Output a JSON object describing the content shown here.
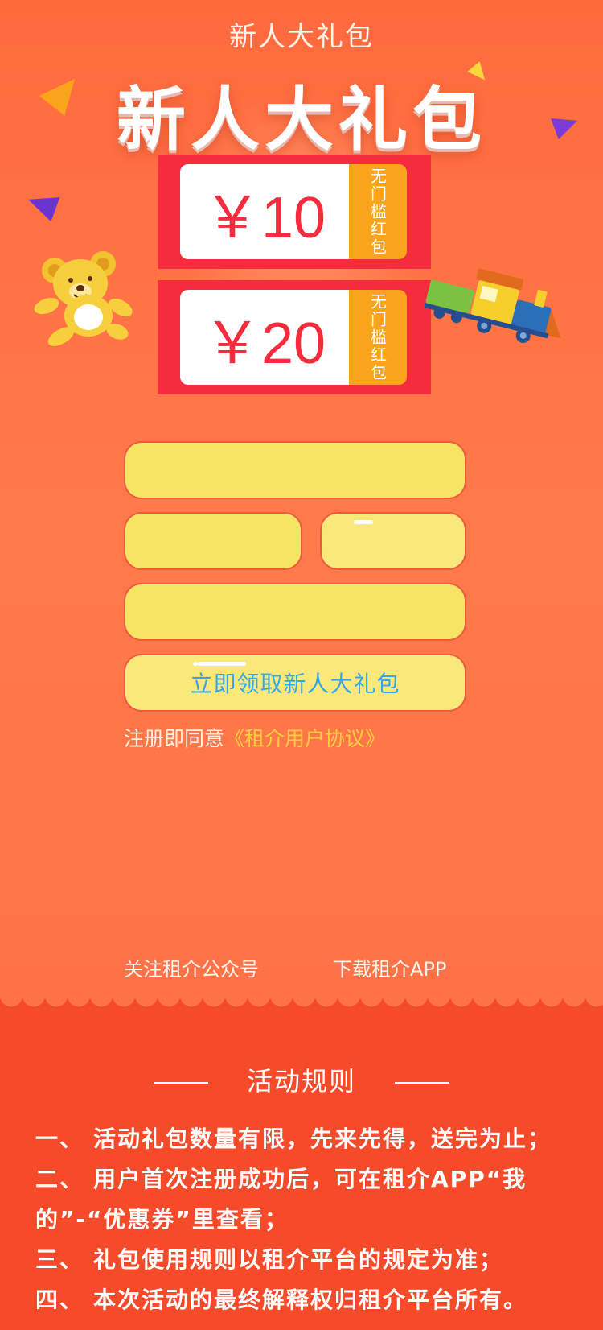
{
  "header": {
    "title": "新人大礼包",
    "hero_title": "新人大礼包"
  },
  "coupons": [
    {
      "amount": "￥10",
      "tag": "无门槛红包"
    },
    {
      "amount": "￥20",
      "tag": "无门槛红包"
    }
  ],
  "form": {
    "phone_value": "",
    "code_value": "",
    "password_value": "",
    "submit_label": "立即领取新人大礼包",
    "agreement_prefix": "注册即同意",
    "agreement_link": "《租介用户协议》"
  },
  "footer_links": {
    "wechat": "关注租介公众号",
    "app": "下载租介APP"
  },
  "rules": {
    "title": "活动规则",
    "items": [
      {
        "num": "一、",
        "text": "活动礼包数量有限，先来先得，送完为止；"
      },
      {
        "num": "二、",
        "text": "用户首次注册成功后，可在租介APP“我的”-“优惠券”里查看；"
      },
      {
        "num": "三、",
        "text": "礼包使用规则以租介平台的规定为准；"
      },
      {
        "num": "四、",
        "text": "本次活动的最终解释权归租介平台所有。"
      }
    ]
  },
  "colors": {
    "background": "#ff7248",
    "coupon_red": "#f42c3d",
    "coupon_tag": "#f9a41a",
    "field_yellow": "#f6e563",
    "button_text": "#36a6e6",
    "agreement_link": "#fbcf3d",
    "rules_bg": "#f64b2b"
  },
  "icons": [
    "teddy-bear-icon",
    "toy-train-icon",
    "paper-plane-icon"
  ]
}
